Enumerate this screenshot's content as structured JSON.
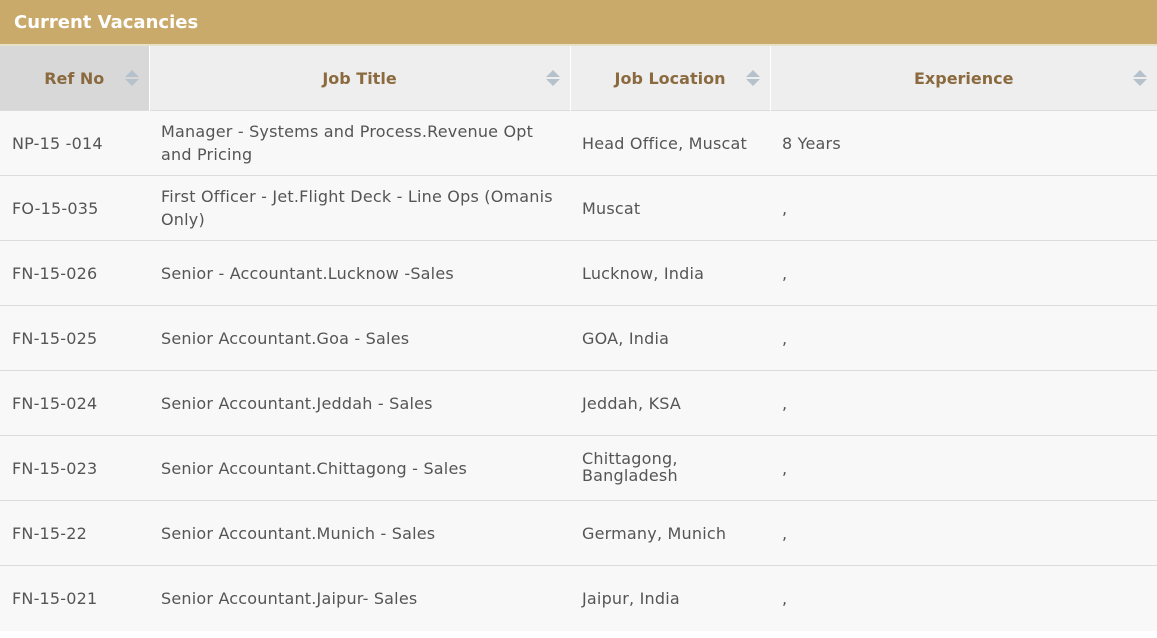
{
  "panel": {
    "title": "Current Vacancies"
  },
  "colors": {
    "header_bg": "#c9aa6a",
    "column_header_text": "#8a6a3e",
    "body_text": "#555555"
  },
  "table": {
    "columns": [
      "Ref No",
      "Job Title",
      "Job Location",
      "Experience"
    ],
    "rows": [
      {
        "ref": "NP-15 -014",
        "title": "Manager - Systems and Process.Revenue Opt and Pricing",
        "location": "Head Office, Muscat",
        "experience": "8 Years"
      },
      {
        "ref": "FO-15-035",
        "title": "First Officer - Jet.Flight Deck - Line Ops (Omanis Only)",
        "location": "Muscat",
        "experience": ","
      },
      {
        "ref": "FN-15-026",
        "title": "Senior - Accountant.Lucknow -Sales",
        "location": "Lucknow, India",
        "experience": ","
      },
      {
        "ref": "FN-15-025",
        "title": "Senior Accountant.Goa - Sales",
        "location": "GOA, India",
        "experience": ","
      },
      {
        "ref": "FN-15-024",
        "title": "Senior Accountant.Jeddah - Sales",
        "location": "Jeddah, KSA",
        "experience": ","
      },
      {
        "ref": "FN-15-023",
        "title": "Senior Accountant.Chittagong - Sales",
        "location": "Chittagong, Bangladesh",
        "experience": ","
      },
      {
        "ref": "FN-15-22",
        "title": "Senior Accountant.Munich - Sales",
        "location": "Germany, Munich",
        "experience": ","
      },
      {
        "ref": "FN-15-021",
        "title": "Senior Accountant.Jaipur- Sales",
        "location": "Jaipur, India",
        "experience": ","
      }
    ]
  },
  "icons": {
    "sort": "sort-icon"
  }
}
